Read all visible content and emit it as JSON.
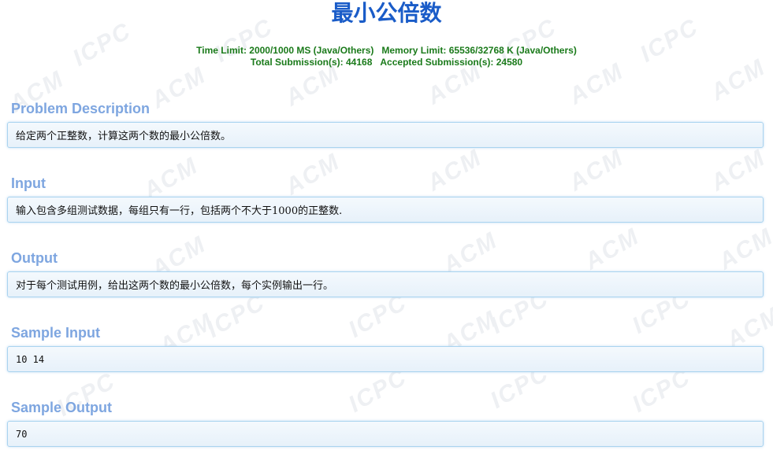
{
  "problem": {
    "title": "最小公倍数",
    "time_limit": "Time Limit: 2000/1000 MS (Java/Others)",
    "memory_limit": "Memory Limit: 65536/32768 K (Java/Others)",
    "total_submissions": "Total Submission(s): 44168",
    "accepted_submissions": "Accepted Submission(s): 24580"
  },
  "sections": {
    "description": {
      "heading": "Problem Description",
      "content": "给定两个正整数，计算这两个数的最小公倍数。"
    },
    "input": {
      "heading": "Input",
      "content": "输入包含多组测试数据，每组只有一行，包括两个不大于1000的正整数."
    },
    "output": {
      "heading": "Output",
      "content": "对于每个测试用例，给出这两个数的最小公倍数，每个实例输出一行。"
    },
    "sample_input": {
      "heading": "Sample Input",
      "content": "10 14"
    },
    "sample_output": {
      "heading": "Sample Output",
      "content": "70"
    }
  },
  "watermark": {
    "words": [
      "ACM",
      "ICPC"
    ]
  },
  "colors": {
    "title": "#1a5cc8",
    "limits": "#1a7a1a",
    "section_heading": "#7ea6e0",
    "panel_border": "#a9d3ef"
  }
}
